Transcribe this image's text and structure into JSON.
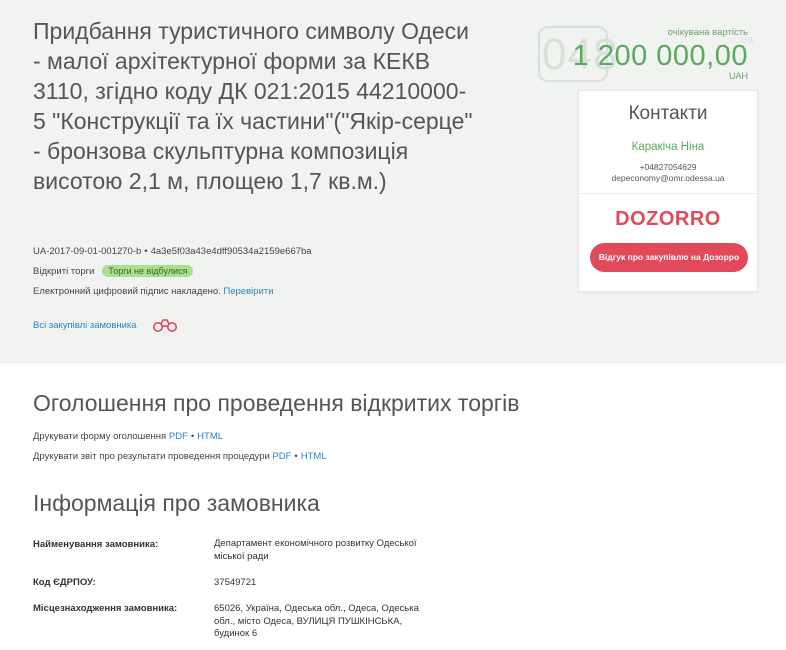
{
  "tender": {
    "title": "Придбання туристичного символу Одеси - малої архітектурної форми за КЕКВ 3110, згідно коду ДК 021:2015 44210000-5 \"Конструкції та їх частини\"(\"Якір-серце\" - бронзова скульптурна композиція висотою 2,1 м, площею 1,7 кв.м.)",
    "id": "UA-2017-09-01-001270-b",
    "hash": "4a3e5f03a43e4dff90534a2159e667ba",
    "procedure_type": "Відкриті торги",
    "status_badge": "Торги не відбулися",
    "signature_text": "Електронний цифровий підпис накладено.",
    "verify_link": "Перевірити",
    "all_purchases_link": "Всі закупівлі замовника"
  },
  "price": {
    "label": "очікувана вартість",
    "value": "1 200 000,00",
    "currency": "UAH"
  },
  "watermark": {
    "text": "048",
    "small": ".ua"
  },
  "contacts": {
    "title": "Контакти",
    "name": "Каракіча Ніна",
    "phone": "+04827054629",
    "email": "depeconomy@omr.odessa.ua"
  },
  "dozorro": {
    "logo": "DOZORRO",
    "button": "Відгук про закупівлю на Дозорро"
  },
  "announcement": {
    "title": "Оголошення про проведення відкритих торгів",
    "print_form_label": "Друкувати форму оголошення",
    "print_report_label": "Друкувати звіт про результати проведення процедури",
    "pdf": "PDF",
    "html": "HTML"
  },
  "customer": {
    "title": "Інформація про замовника",
    "rows": [
      {
        "label": "Найменування замовника:",
        "value": "Департамент економічного розвитку Одеської міської ради"
      },
      {
        "label": "Код ЄДРПОУ:",
        "value": "37549721"
      },
      {
        "label": "Місцезнаходження замовника:",
        "value": "65026, Україна, Одеська обл., Одеса, Одеська обл., місто Одеса, ВУЛИЦЯ ПУШКІНСЬКА, будинок 6"
      }
    ]
  },
  "colors": {
    "top_bg": "#f0f3f0",
    "accent_green": "#5aa95f",
    "dozorro_red": "#e2495a",
    "link_blue": "#2b83c6"
  }
}
